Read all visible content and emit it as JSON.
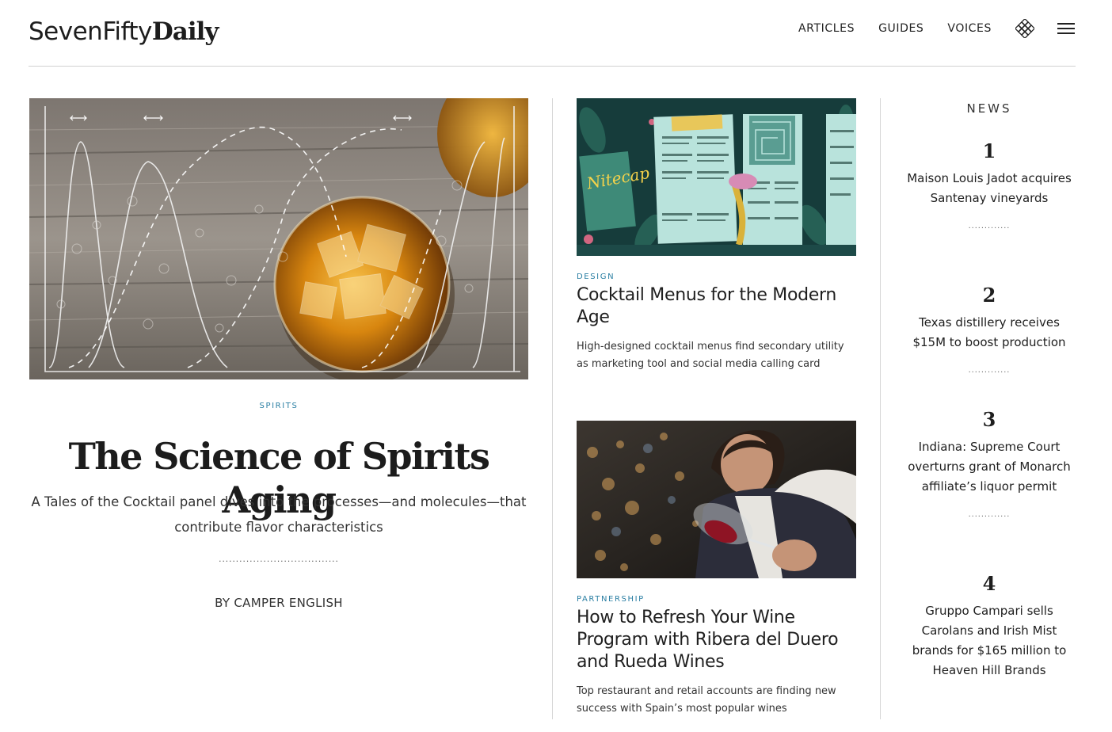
{
  "site": {
    "logo_light": "SevenFifty",
    "logo_bold": "Daily"
  },
  "nav": {
    "items": [
      "ARTICLES",
      "GUIDES",
      "VOICES"
    ],
    "grid_icon": "grid-icon",
    "menu_icon": "hamburger-menu-icon"
  },
  "feature": {
    "kicker": "SPIRITS",
    "title": "The Science of Spirits Aging",
    "dek": "A Tales of the Cocktail panel dives into the processes—and molecules—that contribute flavor characteristics",
    "dots": "...................................",
    "byline": "BY CAMPER ENGLISH"
  },
  "stories": [
    {
      "kicker": "DESIGN",
      "title": "Cocktail Menus for the Modern Age",
      "dek": "High-designed cocktail menus find secondary utility as marketing tool and social media calling card"
    },
    {
      "kicker": "PARTNERSHIP",
      "title": "How to Refresh Your Wine Program with Ribera del Duero and Rueda Wines",
      "dek": "Top restaurant and retail accounts are finding new success with Spain’s most popular wines"
    }
  ],
  "news": {
    "title": "NEWS",
    "dots": ".............",
    "items": [
      {
        "num": "1",
        "headline": "Maison Louis Jadot acquires Santenay vineyards"
      },
      {
        "num": "2",
        "headline": "Texas distillery receives $15M to boost production"
      },
      {
        "num": "3",
        "headline": "Indiana: Supreme Court overturns grant of Monarch affiliate’s liquor permit"
      },
      {
        "num": "4",
        "headline": "Gruppo Campari sells Carolans and Irish Mist brands for $165 million to Heaven Hill Brands"
      }
    ]
  },
  "colors": {
    "accent": "#2b7fa3",
    "text": "#222222",
    "rule": "#d0d0d0"
  }
}
